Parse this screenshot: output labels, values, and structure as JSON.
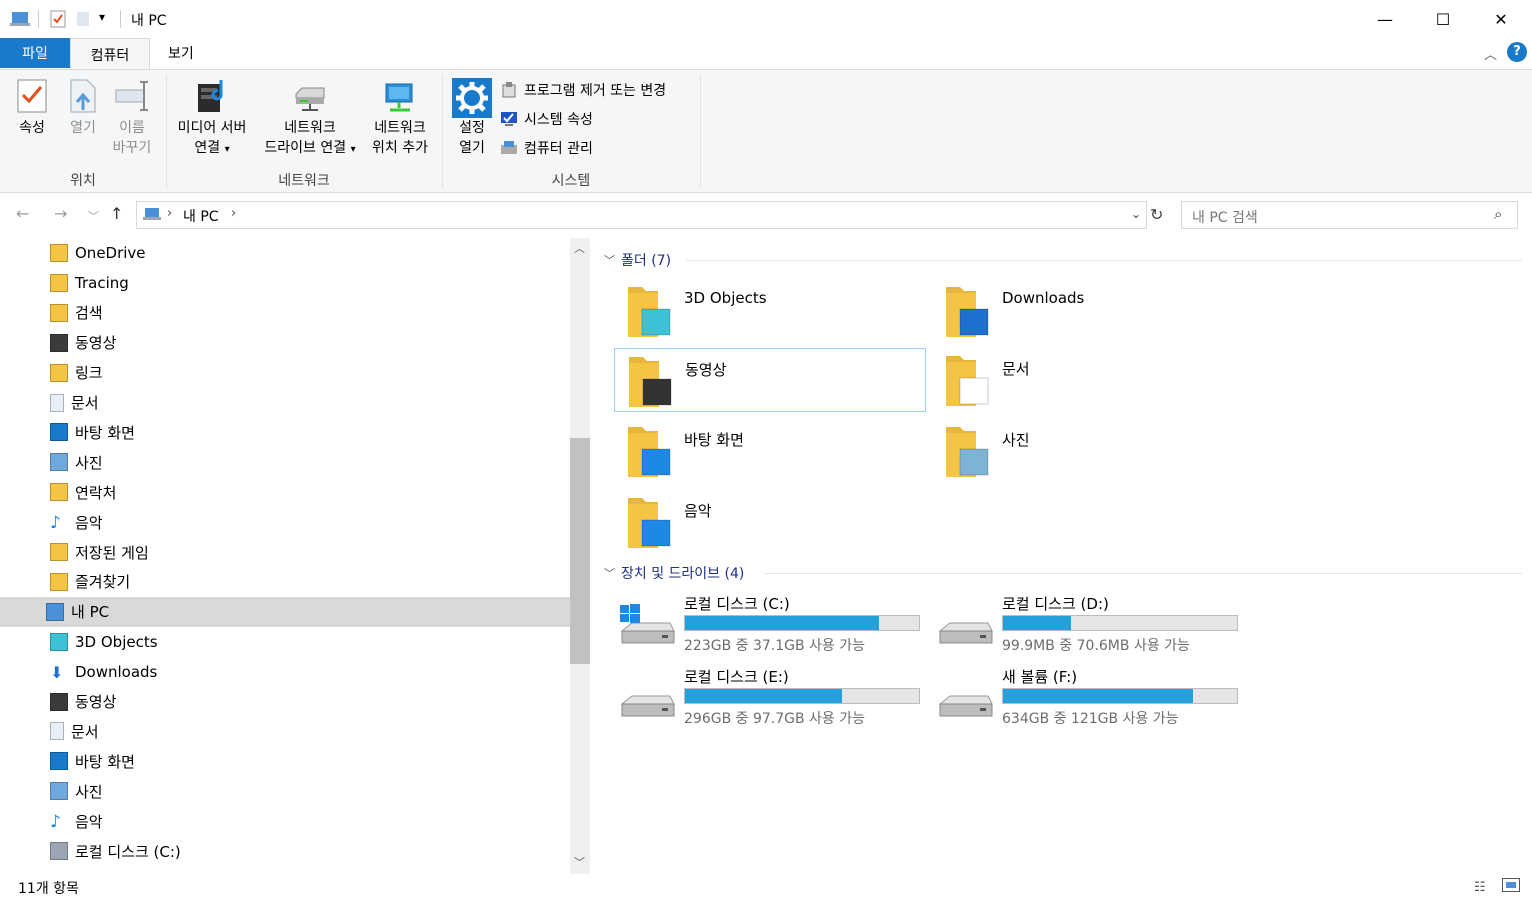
{
  "window": {
    "title": "내 PC",
    "minimize": "—",
    "maximize": "☐",
    "close": "✕"
  },
  "tabs": {
    "file": "파일",
    "computer": "컴퓨터",
    "view": "보기"
  },
  "ribbon": {
    "properties": "속성",
    "open": "열기",
    "rename_1": "이름",
    "rename_2": "바꾸기",
    "group_location": "위치",
    "media_1": "미디어 서버",
    "media_2": "연결",
    "map_drive_1": "네트워크",
    "map_drive_2": "드라이브 연결",
    "add_loc_1": "네트워크",
    "add_loc_2": "위치 추가",
    "group_network": "네트워크",
    "settings_1": "설정",
    "settings_2": "열기",
    "uninstall": "프로그램 제거 또는 변경",
    "sys_props": "시스템 속성",
    "manage": "컴퓨터 관리",
    "group_system": "시스템"
  },
  "nav": {
    "breadcrumb": "내 PC",
    "search_placeholder": "내 PC 검색"
  },
  "tree": [
    {
      "label": "OneDrive",
      "icon": "onedrive-folder-icon"
    },
    {
      "label": "Tracing",
      "icon": "folder-icon"
    },
    {
      "label": "검색",
      "icon": "search-folder-icon"
    },
    {
      "label": "동영상",
      "icon": "video-icon"
    },
    {
      "label": "링크",
      "icon": "links-folder-icon"
    },
    {
      "label": "문서",
      "icon": "document-icon"
    },
    {
      "label": "바탕 화면",
      "icon": "desktop-icon"
    },
    {
      "label": "사진",
      "icon": "pictures-icon"
    },
    {
      "label": "연락처",
      "icon": "contacts-icon"
    },
    {
      "label": "음악",
      "icon": "music-icon"
    },
    {
      "label": "저장된 게임",
      "icon": "saved-games-icon"
    },
    {
      "label": "즐겨찾기",
      "icon": "favorites-icon"
    },
    {
      "label": "내 PC",
      "icon": "this-pc-icon"
    },
    {
      "label": "3D Objects",
      "icon": "3d-objects-icon"
    },
    {
      "label": "Downloads",
      "icon": "downloads-icon"
    },
    {
      "label": "동영상",
      "icon": "video-icon"
    },
    {
      "label": "문서",
      "icon": "document-icon"
    },
    {
      "label": "바탕 화면",
      "icon": "desktop-icon"
    },
    {
      "label": "사진",
      "icon": "pictures-icon"
    },
    {
      "label": "음악",
      "icon": "music-icon"
    },
    {
      "label": "로컬 디스크 (C:)",
      "icon": "system-drive-icon"
    }
  ],
  "content": {
    "folders_header": "폴더 (7)",
    "drives_header": "장치 및 드라이브 (4)",
    "folders": [
      {
        "label": "3D Objects",
        "icon": "3d-objects-folder-icon"
      },
      {
        "label": "Downloads",
        "icon": "downloads-folder-icon"
      },
      {
        "label": "동영상",
        "icon": "videos-folder-icon"
      },
      {
        "label": "문서",
        "icon": "documents-folder-icon"
      },
      {
        "label": "바탕 화면",
        "icon": "desktop-folder-icon"
      },
      {
        "label": "사진",
        "icon": "pictures-folder-icon"
      },
      {
        "label": "음악",
        "icon": "music-folder-icon"
      }
    ],
    "drives": [
      {
        "label": "로컬 디스크 (C:)",
        "info": "223GB 중 37.1GB 사용 가능",
        "used_fraction": 0.83
      },
      {
        "label": "로컬 디스크 (D:)",
        "info": "99.9MB 중 70.6MB 사용 가능",
        "used_fraction": 0.29
      },
      {
        "label": "로컬 디스크 (E:)",
        "info": "296GB 중 97.7GB 사용 가능",
        "used_fraction": 0.67
      },
      {
        "label": "새 볼륨 (F:)",
        "info": "634GB 중 121GB 사용 가능",
        "used_fraction": 0.81
      }
    ]
  },
  "status": {
    "count": "11개 항목"
  },
  "colors": {
    "accent": "#1979ca",
    "drive_bar": "#26a0da",
    "section_header": "#1e3287",
    "folder_yellow": "#f4c542"
  }
}
